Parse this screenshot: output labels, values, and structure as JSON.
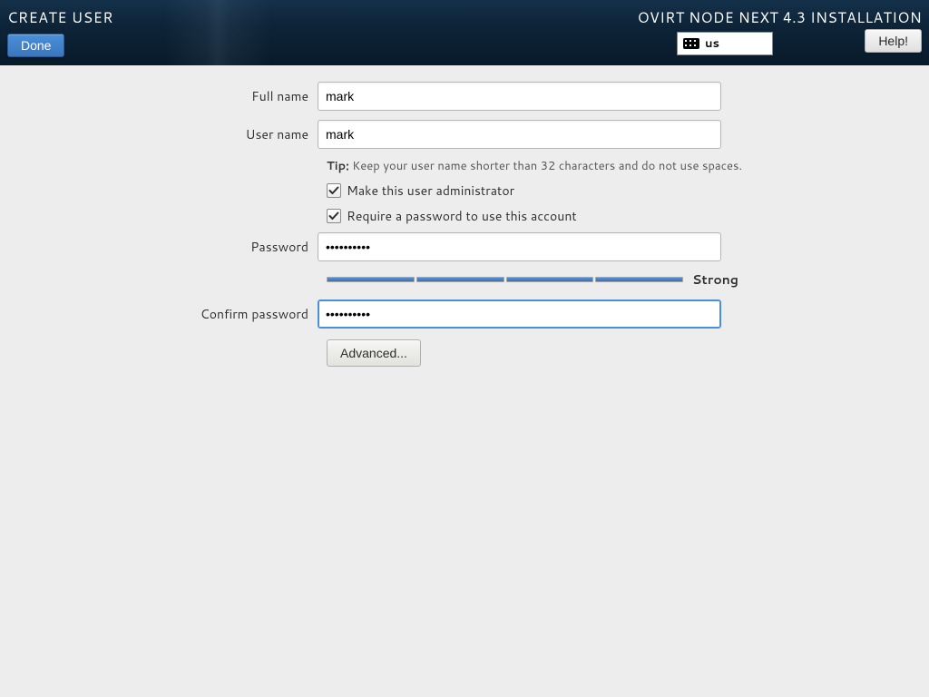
{
  "header": {
    "title": "CREATE USER",
    "installer_title": "OVIRT NODE NEXT 4.3 INSTALLATION",
    "done_label": "Done",
    "help_label": "Help!",
    "keyboard_layout": "us"
  },
  "form": {
    "full_name_label": "Full name",
    "full_name_value": "mark",
    "user_name_label": "User name",
    "user_name_value": "mark",
    "tip_prefix": "Tip:",
    "tip_text": "Keep your user name shorter than 32 characters and do not use spaces.",
    "admin_checkbox_label": "Make this user administrator",
    "admin_checked": true,
    "require_password_label": "Require a password to use this account",
    "require_password_checked": true,
    "password_label": "Password",
    "password_value": "••••••••••",
    "confirm_label": "Confirm password",
    "confirm_value": "••••••••••",
    "strength_label": "Strong",
    "strength_segments": 4,
    "advanced_label": "Advanced..."
  }
}
